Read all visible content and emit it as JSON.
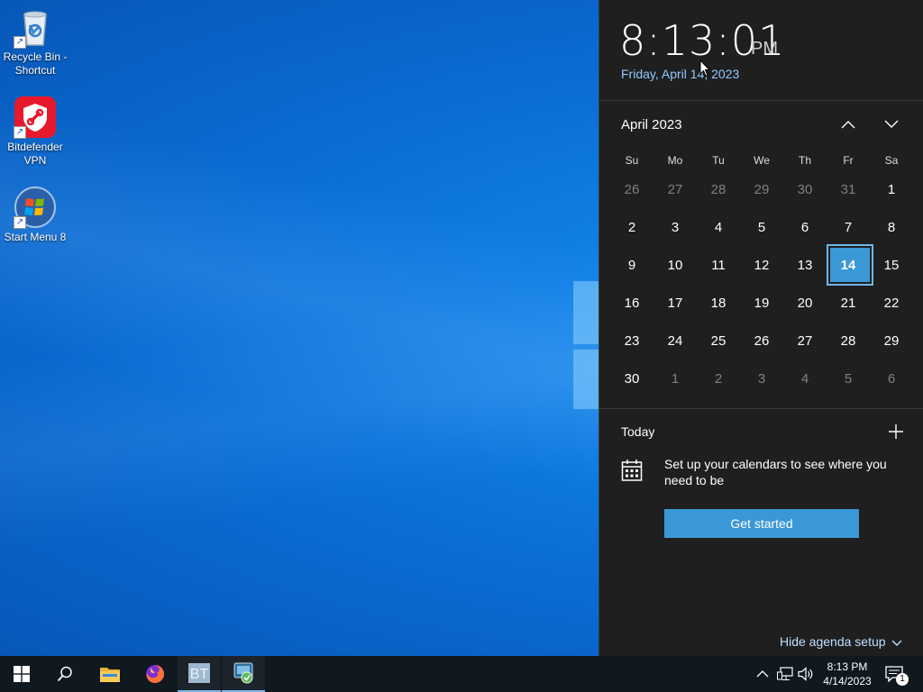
{
  "desktop": {
    "icons": [
      {
        "label": "Recycle Bin - Shortcut",
        "icon": "recycle-bin-icon"
      },
      {
        "label": "Bitdefender VPN",
        "icon": "bitdefender-vpn-icon"
      },
      {
        "label": "Start Menu 8",
        "icon": "start-menu-8-icon"
      }
    ]
  },
  "flyout": {
    "time": "8:13:01",
    "ampm": "PM",
    "date": "Friday, April 14, 2023",
    "month_label": "April 2023",
    "weekdays": [
      "Su",
      "Mo",
      "Tu",
      "We",
      "Th",
      "Fr",
      "Sa"
    ],
    "weeks": [
      [
        "26",
        "27",
        "28",
        "29",
        "30",
        "31",
        "1"
      ],
      [
        "2",
        "3",
        "4",
        "5",
        "6",
        "7",
        "8"
      ],
      [
        "9",
        "10",
        "11",
        "12",
        "13",
        "14",
        "15"
      ],
      [
        "16",
        "17",
        "18",
        "19",
        "20",
        "21",
        "22"
      ],
      [
        "23",
        "24",
        "25",
        "26",
        "27",
        "28",
        "29"
      ],
      [
        "30",
        "1",
        "2",
        "3",
        "4",
        "5",
        "6"
      ]
    ],
    "today_day": "14",
    "agenda": {
      "today_label": "Today",
      "setup_text": "Set up your calendars to see where you need to be",
      "get_started_label": "Get started",
      "hide_agenda_label": "Hide agenda setup"
    }
  },
  "taskbar": {
    "time": "8:13 PM",
    "date": "4/14/2023",
    "notification_count": "1",
    "apps": [
      "windows-start-icon",
      "search-icon",
      "file-explorer-icon",
      "firefox-icon",
      "bt-app-icon",
      "network-tool-icon"
    ]
  },
  "colors": {
    "accent": "#3b98d6",
    "flyout_bg": "#1f1f1f",
    "taskbar_bg": "#101820",
    "date_link": "#8fc8ff"
  }
}
